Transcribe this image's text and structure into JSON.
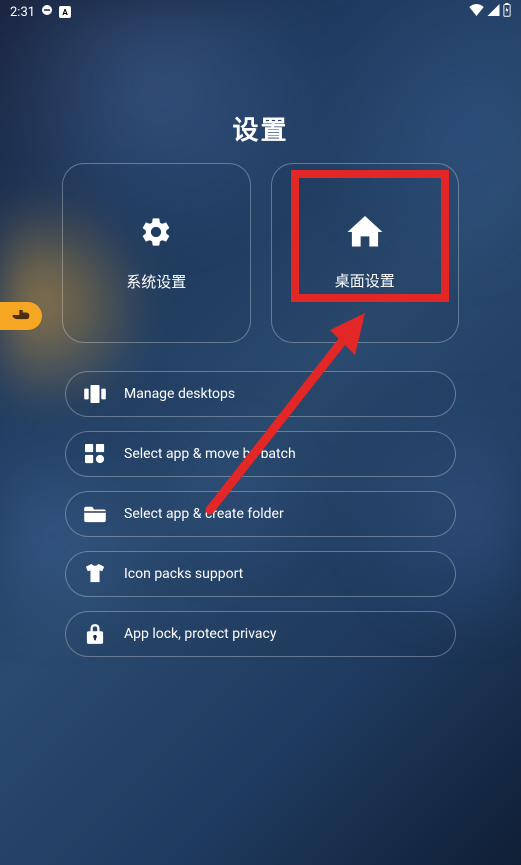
{
  "status_bar": {
    "time": "2:31"
  },
  "page_title": "设置",
  "cards": {
    "system": {
      "label": "系统设置"
    },
    "desktop": {
      "label": "桌面设置"
    }
  },
  "list_items": [
    {
      "label": "Manage desktops"
    },
    {
      "label": "Select app & move by batch"
    },
    {
      "label": "Select app & create folder"
    },
    {
      "label": "Icon packs support"
    },
    {
      "label": "App lock, protect privacy"
    }
  ],
  "annotations": {
    "highlight_target": "desktop-settings-card",
    "arrow_color": "#e32626"
  }
}
